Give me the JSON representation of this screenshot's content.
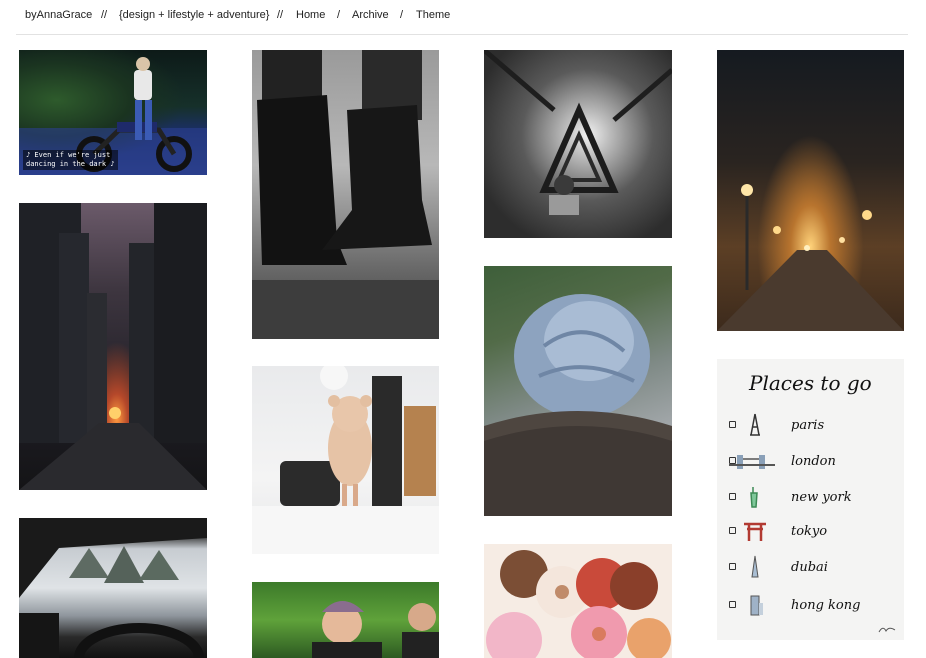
{
  "nav": {
    "blog_name": "byAnnaGrace",
    "sep1": "//",
    "tagline": "{design + lifestyle + adventure}",
    "sep2": "//",
    "home": "Home",
    "sep3": "/",
    "archive": "Archive",
    "sep4": "/",
    "theme": "Theme"
  },
  "tiles": {
    "motorcycle_caption_line1": "♪ Even if we're just",
    "motorcycle_caption_line2": "dancing in the dark ♪"
  },
  "places_card": {
    "title": "Places to go",
    "items": [
      {
        "name": "paris",
        "icon": "eiffel-tower-icon"
      },
      {
        "name": "london",
        "icon": "tower-bridge-icon"
      },
      {
        "name": "new york",
        "icon": "statue-of-liberty-icon"
      },
      {
        "name": "tokyo",
        "icon": "japanese-gate-icon"
      },
      {
        "name": "dubai",
        "icon": "burj-tower-icon"
      },
      {
        "name": "hong kong",
        "icon": "skyscraper-icon"
      }
    ]
  }
}
